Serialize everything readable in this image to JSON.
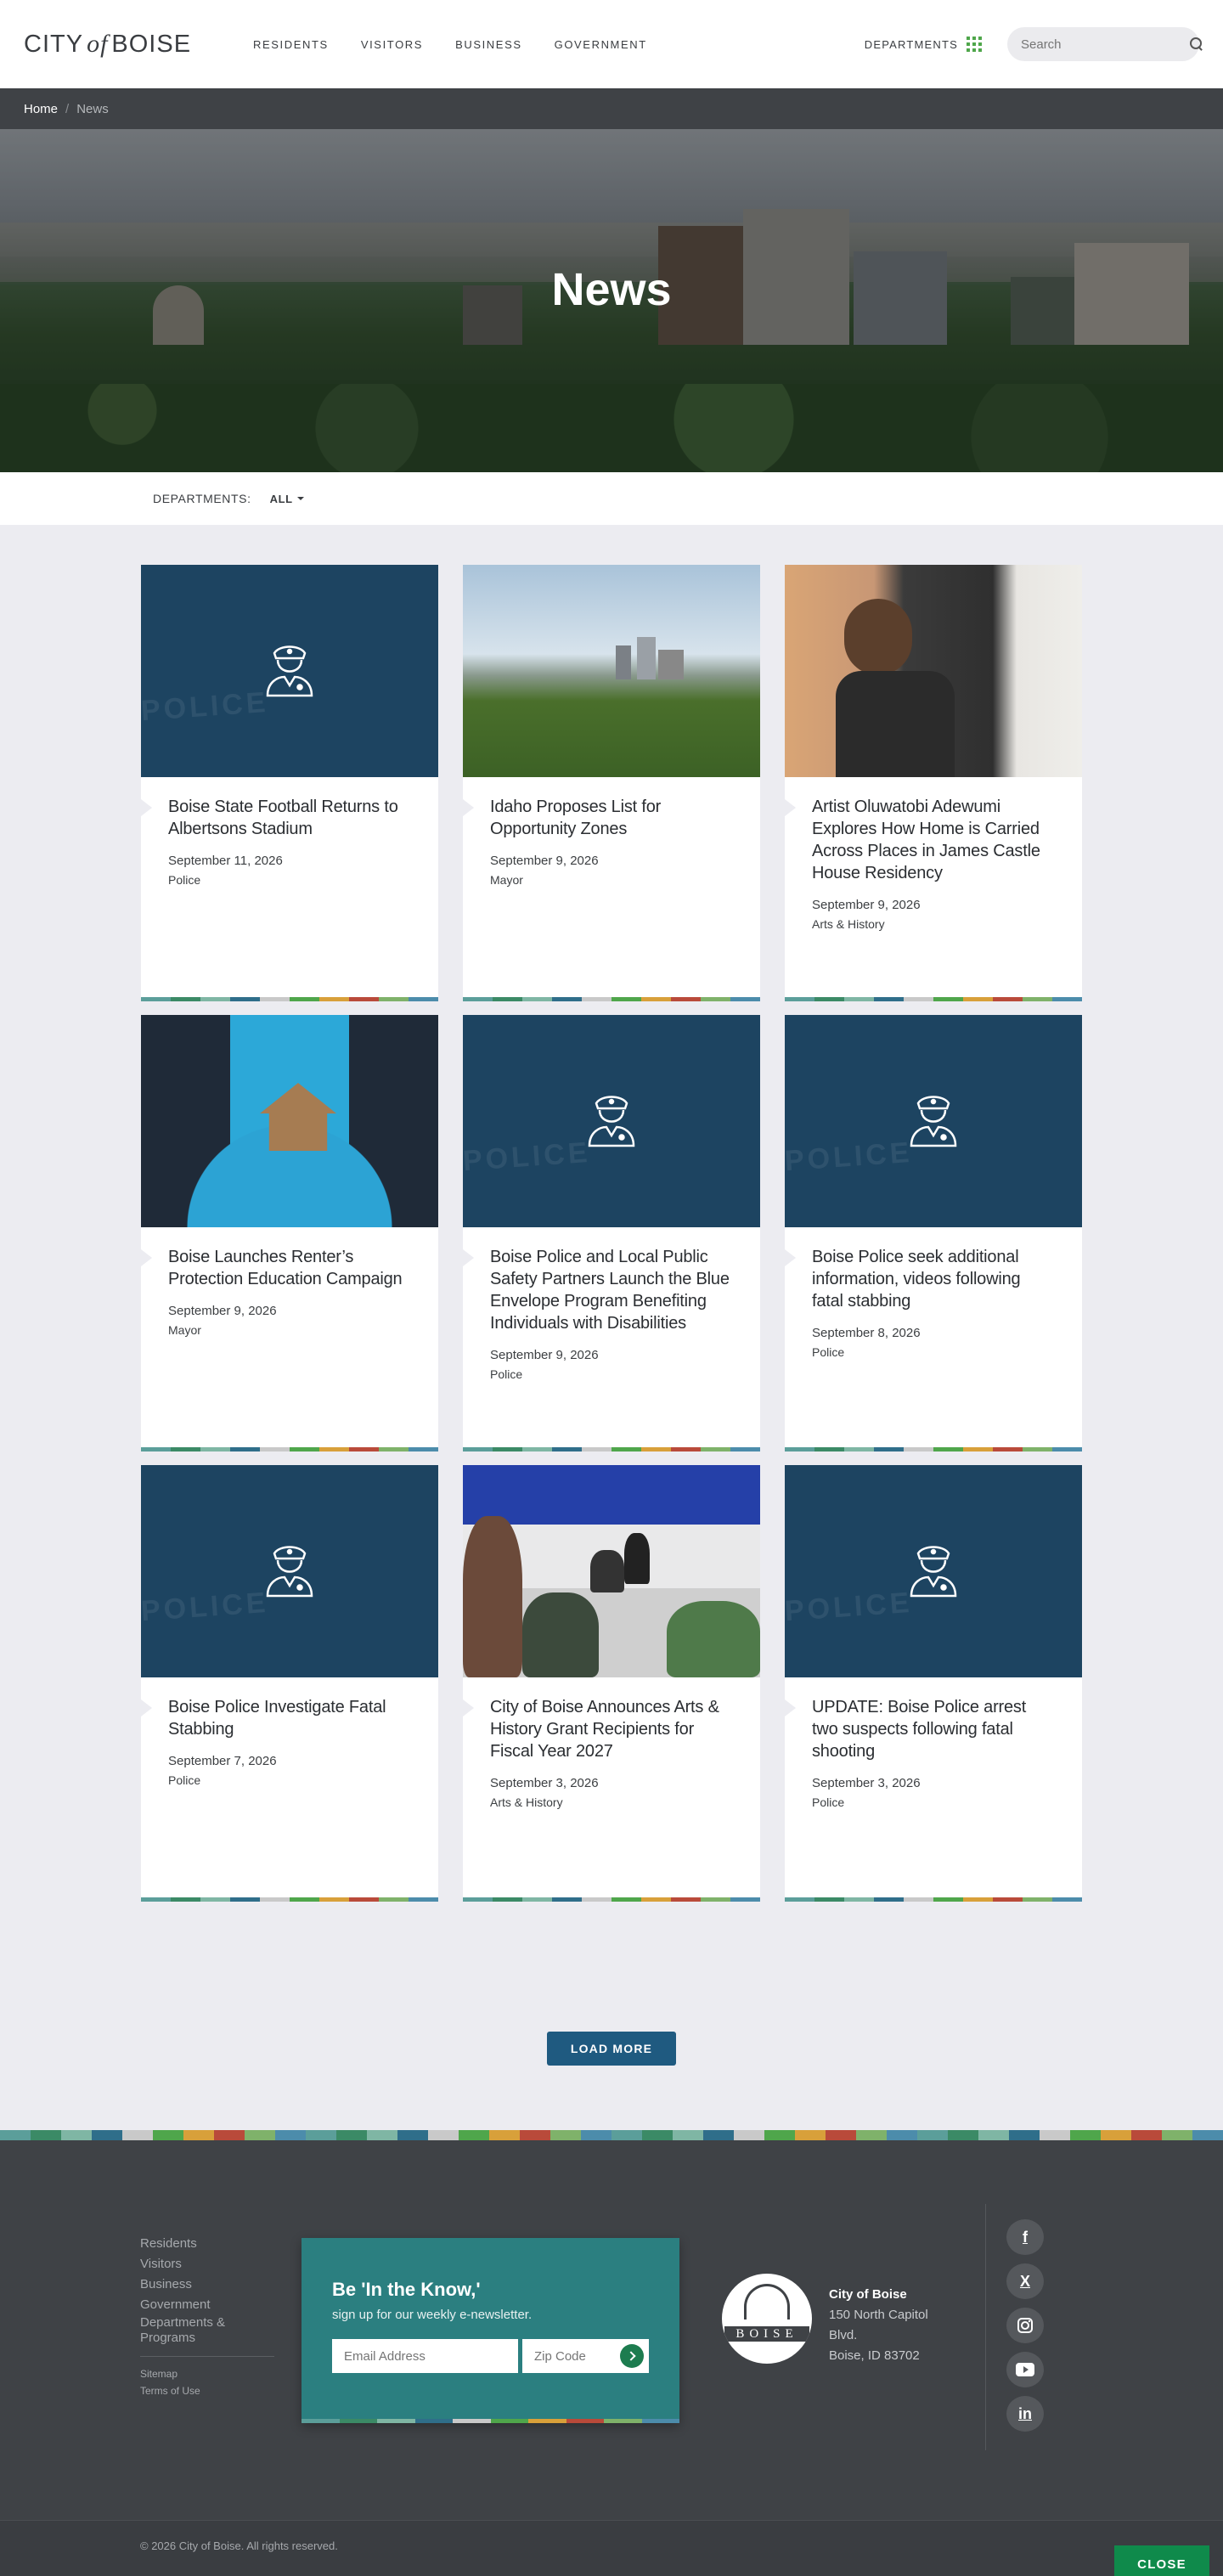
{
  "header": {
    "logo_city": "CITY",
    "logo_of": "of",
    "logo_boise": "BOISE",
    "nav": [
      "RESIDENTS",
      "VISITORS",
      "BUSINESS",
      "GOVERNMENT"
    ],
    "departments_label": "DEPARTMENTS",
    "search_placeholder": "Search"
  },
  "breadcrumb": {
    "home": "Home",
    "separator": "/",
    "current": "News"
  },
  "hero": {
    "title": "News"
  },
  "filter": {
    "label": "DEPARTMENTS:",
    "value": "ALL"
  },
  "cards": [
    {
      "image": "police-icon",
      "title": "Boise State Football Returns to Albertsons Stadium",
      "date": "September 11, 2026",
      "department": "Police"
    },
    {
      "image": "city-skyline-photo",
      "title": "Idaho Proposes List for Opportunity Zones",
      "date": "September 9, 2026",
      "department": "Mayor"
    },
    {
      "image": "artist-photo",
      "title": "Artist Oluwatobi Adewumi Explores How Home is Carried Across Places in James Castle House Residency",
      "date": "September 9, 2026",
      "department": "Arts & History"
    },
    {
      "image": "cardboard-house-photo",
      "title": "Boise Launches Renter’s Protection Education Campaign",
      "date": "September 9, 2026",
      "department": "Mayor"
    },
    {
      "image": "police-icon",
      "title": "Boise Police and Local Public Safety Partners Launch the Blue Envelope Program Benefiting Individuals with Disabilities",
      "date": "September 9, 2026",
      "department": "Police"
    },
    {
      "image": "police-icon",
      "title": "Boise Police seek additional information, videos following fatal stabbing",
      "date": "September 8, 2026",
      "department": "Police"
    },
    {
      "image": "police-icon",
      "title": "Boise Police Investigate Fatal Stabbing",
      "date": "September 7, 2026",
      "department": "Police"
    },
    {
      "image": "dance-class-photo",
      "title": "City of Boise Announces Arts & History Grant Recipients for Fiscal Year 2027",
      "date": "September 3, 2026",
      "department": "Arts & History"
    },
    {
      "image": "police-icon",
      "title": "UPDATE: Boise Police arrest two suspects following fatal shooting",
      "date": "September 3, 2026",
      "department": "Police"
    }
  ],
  "police_watermark": "POLICE",
  "load_more": "LOAD MORE",
  "footer": {
    "links": [
      "Residents",
      "Visitors",
      "Business",
      "Government",
      "Departments & Programs"
    ],
    "small_links": [
      "Sitemap",
      "Terms of Use"
    ],
    "newsletter_title": "Be 'In the Know,'",
    "newsletter_subtitle": "sign up for our weekly e-newsletter.",
    "email_placeholder": "Email Address",
    "zip_placeholder": "Zip Code",
    "seal_text": "BOISE",
    "address_name": "City of Boise",
    "address_line1": "150 North Capitol Blvd.",
    "address_line2": "Boise, ID 83702",
    "social": [
      "facebook-icon",
      "x-icon",
      "instagram-icon",
      "youtube-icon",
      "linkedin-icon"
    ],
    "copyright": "© 2026 City of Boise. All rights reserved.",
    "close_label": "CLOSE"
  },
  "colors": {
    "strip": [
      "#5b9e9a",
      "#3b8a66",
      "#7fb6a4",
      "#2f6e8a",
      "#c9c9c9",
      "#4fa64b",
      "#d8a03a",
      "#b94a3a",
      "#7fb26a",
      "#4c8cab"
    ]
  }
}
